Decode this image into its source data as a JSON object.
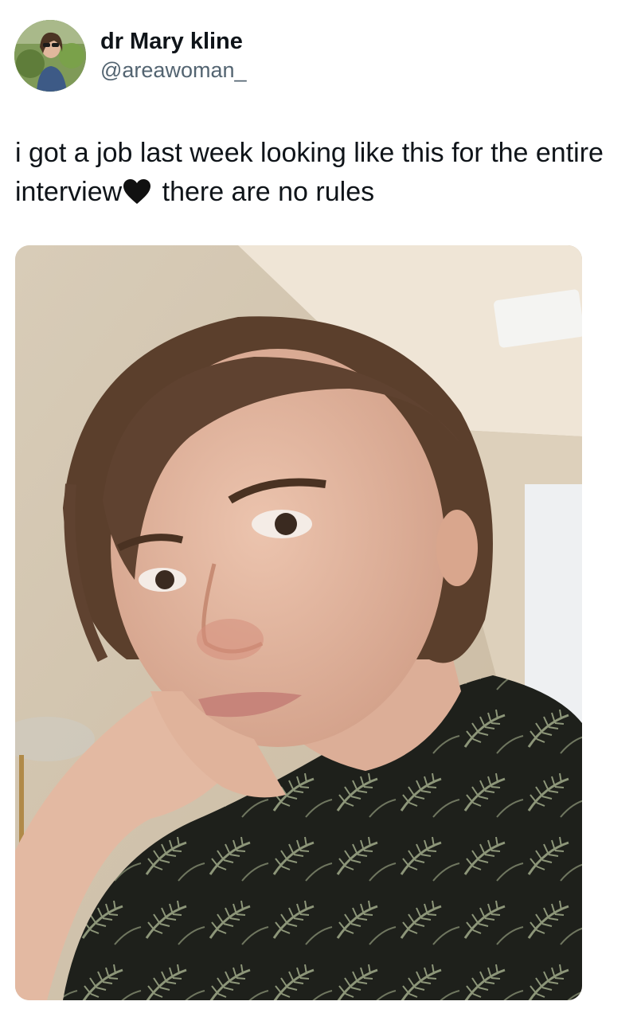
{
  "tweet": {
    "author": {
      "display_name": "dr Mary kline",
      "handle": "@areawoman_"
    },
    "text_part1": "i got a job last week looking like this for the entire interview",
    "emoji": "black-heart-icon",
    "text_part2": " there are no rules"
  },
  "colors": {
    "text": "#0f1419",
    "handle": "#536471",
    "background": "#ffffff"
  }
}
